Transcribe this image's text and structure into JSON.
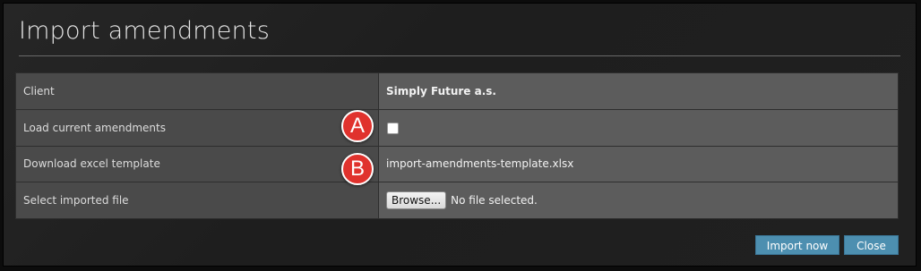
{
  "dialog": {
    "title": "Import amendments"
  },
  "form": {
    "rows": [
      {
        "label": "Client",
        "value": "Simply Future a.s."
      },
      {
        "label": "Load current amendments",
        "checked": false
      },
      {
        "label": "Download excel template",
        "value": "import-amendments-template.xlsx"
      },
      {
        "label": "Select imported file",
        "browse_label": "Browse...",
        "file_status": "No file selected."
      }
    ]
  },
  "markers": {
    "a": "A",
    "b": "B"
  },
  "buttons": {
    "import_label": "Import now",
    "close_label": "Close"
  },
  "colors": {
    "accent": "#4d8fb0",
    "marker": "#e0322d"
  }
}
